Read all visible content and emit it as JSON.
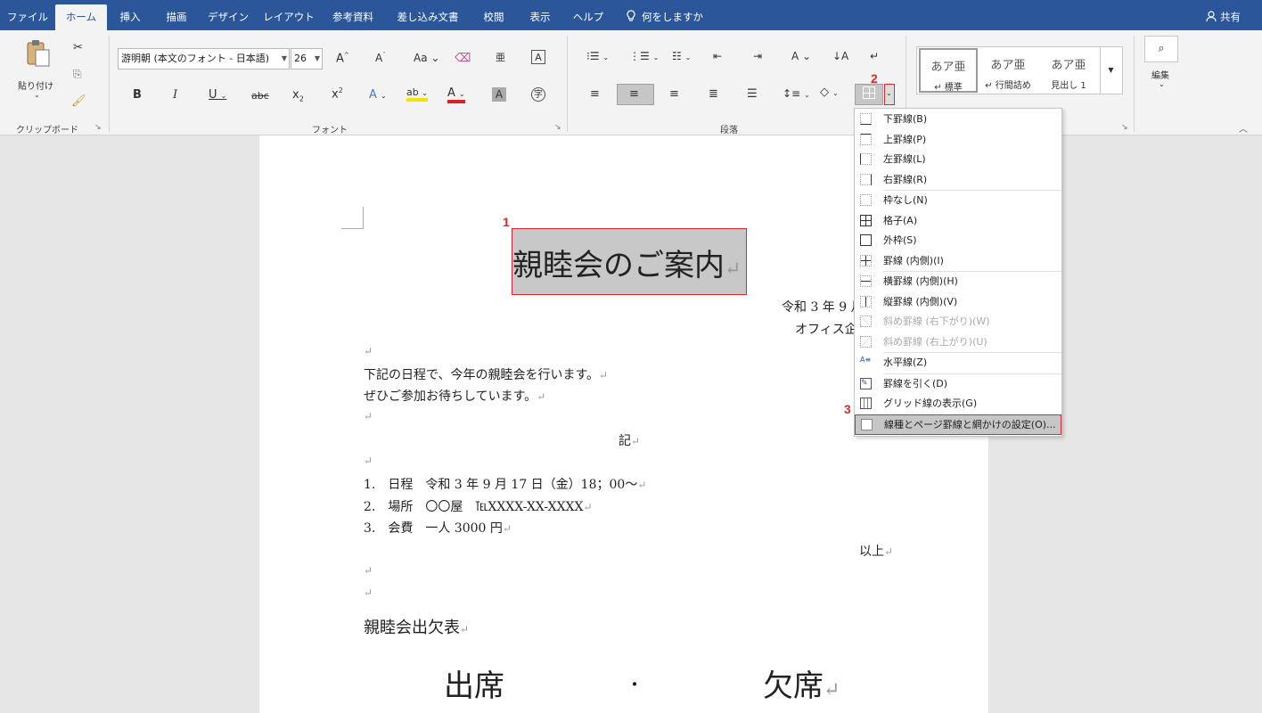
{
  "tabs": [
    "ファイル",
    "ホーム",
    "挿入",
    "描画",
    "デザイン",
    "レイアウト",
    "参考資料",
    "差し込み文書",
    "校閲",
    "表示",
    "ヘルプ"
  ],
  "tell_me": "何をしますか",
  "share": "共有",
  "clipboard": {
    "paste": "貼り付け",
    "group": "クリップボード"
  },
  "font": {
    "name": "游明朝 (本文のフォント - 日本語)",
    "size": "26",
    "group": "フォント"
  },
  "paragraph": {
    "group": "段落"
  },
  "styles": [
    {
      "preview": "あア亜",
      "name": "↵ 標準"
    },
    {
      "preview": "あア亜",
      "name": "↵ 行間詰め"
    },
    {
      "preview": "あア亜",
      "name": "見出し 1"
    }
  ],
  "edit": {
    "label": "編集"
  },
  "border_menu": [
    "下罫線(B)",
    "上罫線(P)",
    "左罫線(L)",
    "右罫線(R)",
    "枠なし(N)",
    "格子(A)",
    "外枠(S)",
    "罫線 (内側)(I)",
    "横罫線 (内側)(H)",
    "縦罫線 (内側)(V)",
    "斜め罫線 (右下がり)(W)",
    "斜め罫線 (右上がり)(U)",
    "水平線(Z)",
    "罫線を引く(D)",
    "グリッド線の表示(G)",
    "線種とページ罫線と網かけの設定(O)..."
  ],
  "doc": {
    "title": "親睦会のご案内",
    "date": "令和 3 年 9 月",
    "company": "オフィス企",
    "body1": "下記の日程で、今年の親睦会を行います。",
    "body2": "ぜひご参加お待ちしています。",
    "ki": "記",
    "item1": "1.　日程　令和 3 年 9 月 17 日（金）18；00〜",
    "item2": "2.　場所　〇〇屋　℡XXXX-XX-XXXX",
    "item3": "3.　会費　一人 3000 円",
    "ijo": "以上",
    "attendance_title": "親睦会出欠表",
    "attend": "出席",
    "dot": "・",
    "absent": "欠席"
  },
  "markers": [
    "1",
    "2",
    "3"
  ]
}
